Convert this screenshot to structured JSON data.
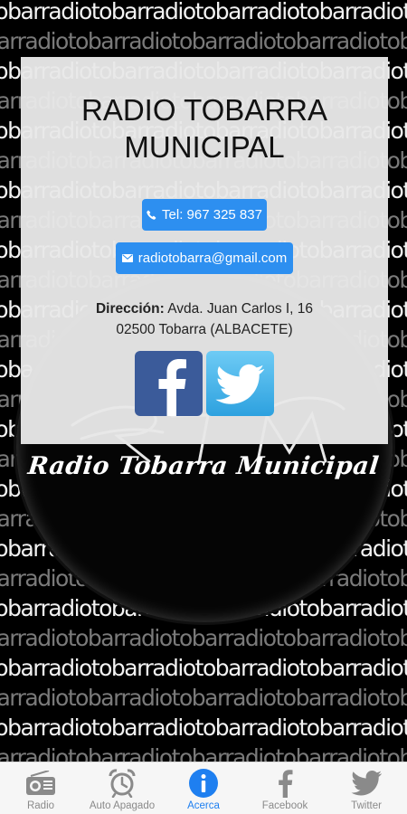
{
  "background": {
    "text": "tobarradiotobarradiotobarradiotobarradiotobarradio"
  },
  "card": {
    "title_line1": "RADIO TOBARRA",
    "title_line2": "MUNICIPAL",
    "phone_label": "Tel: 967 325 837",
    "email_label": "radiotobarra@gmail.com",
    "address_prefix": "Dirección:",
    "address_line1": "Avda. Juan Carlos I, 16",
    "address_line2": "02500 Tobarra (ALBACETE)",
    "facebook_icon": "facebook-icon",
    "twitter_icon": "twitter-icon"
  },
  "logo": {
    "caption": "Radio Tobarra Municipal"
  },
  "tabbar": {
    "active": "Acerca",
    "tabs": [
      {
        "label": "Radio",
        "icon": "radio-icon"
      },
      {
        "label": "Auto Apagado",
        "icon": "alarm-clock-icon"
      },
      {
        "label": "Acerca",
        "icon": "info-icon"
      },
      {
        "label": "Facebook",
        "icon": "facebook-icon"
      },
      {
        "label": "Twitter",
        "icon": "twitter-icon"
      }
    ]
  },
  "colors": {
    "accent": "#2d8ff0",
    "tab_active": "#1e7ff0",
    "facebook": "#3b5b9a",
    "twitter": "#2da1df"
  }
}
